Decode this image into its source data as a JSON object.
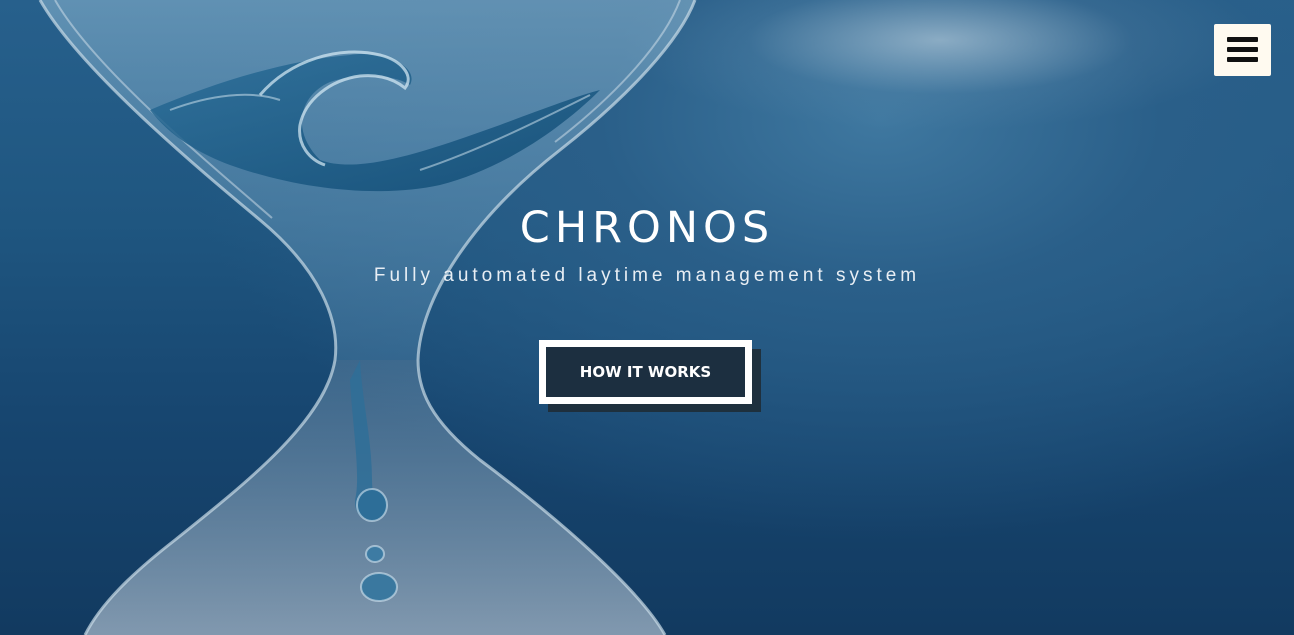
{
  "header": {
    "menu_icon": "hamburger-menu-icon"
  },
  "hero": {
    "title": "CHRONOS",
    "subtitle": "Fully automated laytime management system",
    "cta_label": "HOW IT WORKS",
    "background_image": "hourglass-water-wave-image"
  },
  "colors": {
    "background": "#1f5680",
    "text": "#ffffff",
    "button_fill": "#1c2f40",
    "button_border": "#ffffff",
    "menu_button_bg": "#fffaf0"
  }
}
